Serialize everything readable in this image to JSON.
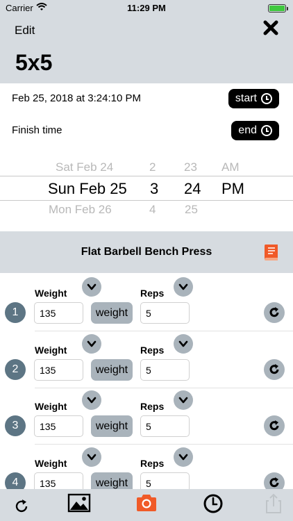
{
  "status_bar": {
    "carrier": "Carrier",
    "time": "11:29 PM"
  },
  "header": {
    "edit_label": "Edit",
    "title": "5x5"
  },
  "start_row": {
    "label": "Feb 25, 2018 at 3:24:10 PM",
    "button": "start"
  },
  "finish_row": {
    "label": "Finish time",
    "button": "end"
  },
  "picker": {
    "prev": {
      "date": "Sat Feb 24",
      "hour": "2",
      "minute": "23",
      "ampm": "AM"
    },
    "selected": {
      "date": "Sun Feb 25",
      "hour": "3",
      "minute": "24",
      "ampm": "PM"
    },
    "next": {
      "date": "Mon Feb 26",
      "hour": "4",
      "minute": "25"
    }
  },
  "exercise": {
    "name": "Flat Barbell Bench Press"
  },
  "set_labels": {
    "weight": "Weight",
    "reps": "Reps",
    "unit": "weight"
  },
  "sets": [
    {
      "number": "1",
      "weight": "135",
      "reps": "5"
    },
    {
      "number": "2",
      "weight": "135",
      "reps": "5"
    },
    {
      "number": "3",
      "weight": "135",
      "reps": "5"
    },
    {
      "number": "4",
      "weight": "135",
      "reps": "5"
    }
  ],
  "colors": {
    "header_bg": "#d6dbe0",
    "accent": "#f05a28",
    "set_badge": "#5d7584",
    "button_grey": "#a9b3bb"
  },
  "toolbar": {
    "icons": [
      "refresh-icon",
      "image-icon",
      "camera-icon",
      "clock-icon",
      "share-icon"
    ]
  }
}
